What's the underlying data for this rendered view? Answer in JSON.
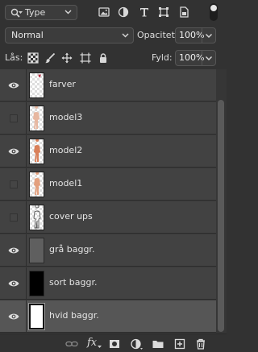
{
  "filter": {
    "kind_label": "Type"
  },
  "blend": {
    "mode": "Normal",
    "opacity_label": "Opacitet:",
    "opacity_value": "100%"
  },
  "lock": {
    "label": "Lås:",
    "fill_label": "Fyld:",
    "fill_value": "100%"
  },
  "layers": [
    {
      "name": "farver",
      "visible": true
    },
    {
      "name": "model3",
      "visible": false
    },
    {
      "name": "model2",
      "visible": true
    },
    {
      "name": "model1",
      "visible": false
    },
    {
      "name": "cover ups",
      "visible": false
    },
    {
      "name": "grå baggr.",
      "visible": true
    },
    {
      "name": "sort baggr.",
      "visible": true
    },
    {
      "name": "hvid baggr.",
      "visible": true,
      "selected": true
    }
  ],
  "footer": {
    "fx_label": "fx"
  },
  "colors": {
    "panel": "#323232",
    "row": "#424242",
    "selected_row": "#565656",
    "text": "#dcdcdc"
  }
}
